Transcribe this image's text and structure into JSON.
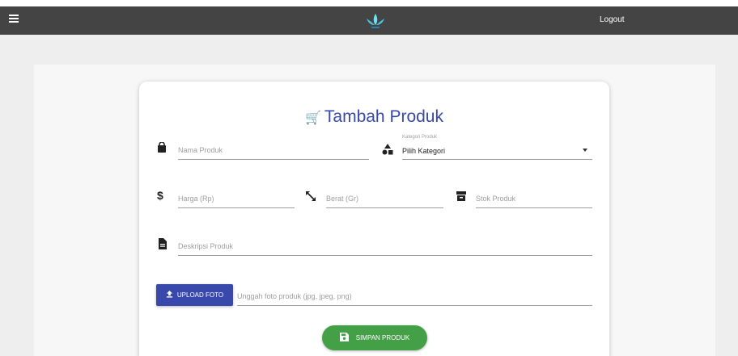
{
  "header": {
    "logout_label": "Logout"
  },
  "icons": {
    "menu": "hamburger-menu-icon",
    "logo": "lotus-logo-icon",
    "cart": "cart-icon",
    "product_name": "shopping-bag-icon",
    "category": "shapes-icon",
    "price": "dollar-icon",
    "weight": "resize-arrows-icon",
    "stock": "archive-box-icon",
    "description": "document-icon",
    "upload": "upload-icon",
    "save": "floppy-disk-icon"
  },
  "colors": {
    "primary": "#3949ab",
    "success": "#43a047",
    "topbar": "#444444"
  },
  "form": {
    "title": "Tambah Produk",
    "title_glyph": "🛒",
    "product_name_placeholder": "Nama Produk",
    "category_label": "Kategori Produk",
    "category_value": "Pilih Kategori",
    "price_placeholder": "Harga (Rp)",
    "weight_placeholder": "Berat (Gr)",
    "stock_placeholder": "Stok Produk",
    "description_placeholder": "Deskripsi Produk",
    "upload_label": "UPLOAD FOTO",
    "upload_hint": "Unggah foto produk (jpg, jpeg, png)",
    "save_label": "SIMPAN PRODUK"
  }
}
